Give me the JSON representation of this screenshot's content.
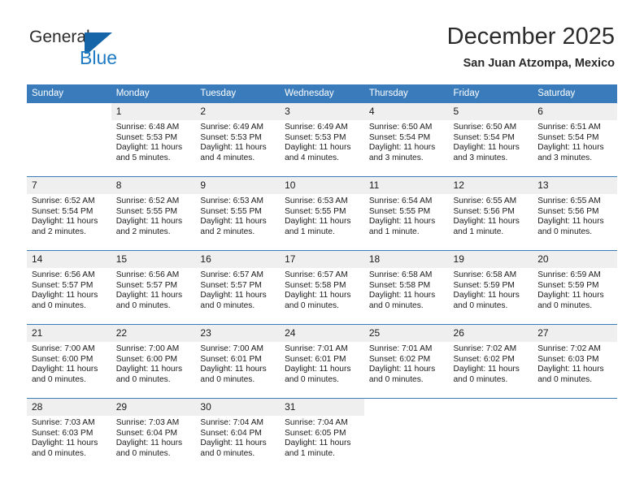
{
  "brand": {
    "name_top": "General",
    "name_bottom": "Blue",
    "mark_icon": "triangle-flag-icon",
    "color_primary": "#1565a8",
    "color_secondary": "#1f7ac4"
  },
  "header": {
    "month_title": "December 2025",
    "location": "San Juan Atzompa, Mexico"
  },
  "theme": {
    "header_row_bg": "#3a7cbb",
    "daynum_bg": "#efefef",
    "text": "#1a1a1a"
  },
  "calendar": {
    "weekday_headers": [
      "Sunday",
      "Monday",
      "Tuesday",
      "Wednesday",
      "Thursday",
      "Friday",
      "Saturday"
    ],
    "weeks": [
      [
        {
          "day": "",
          "blank": true,
          "lines": []
        },
        {
          "day": "1",
          "lines": [
            "Sunrise: 6:48 AM",
            "Sunset: 5:53 PM",
            "Daylight: 11 hours",
            "and 5 minutes."
          ]
        },
        {
          "day": "2",
          "lines": [
            "Sunrise: 6:49 AM",
            "Sunset: 5:53 PM",
            "Daylight: 11 hours",
            "and 4 minutes."
          ]
        },
        {
          "day": "3",
          "lines": [
            "Sunrise: 6:49 AM",
            "Sunset: 5:53 PM",
            "Daylight: 11 hours",
            "and 4 minutes."
          ]
        },
        {
          "day": "4",
          "lines": [
            "Sunrise: 6:50 AM",
            "Sunset: 5:54 PM",
            "Daylight: 11 hours",
            "and 3 minutes."
          ]
        },
        {
          "day": "5",
          "lines": [
            "Sunrise: 6:50 AM",
            "Sunset: 5:54 PM",
            "Daylight: 11 hours",
            "and 3 minutes."
          ]
        },
        {
          "day": "6",
          "lines": [
            "Sunrise: 6:51 AM",
            "Sunset: 5:54 PM",
            "Daylight: 11 hours",
            "and 3 minutes."
          ]
        }
      ],
      [
        {
          "day": "7",
          "lines": [
            "Sunrise: 6:52 AM",
            "Sunset: 5:54 PM",
            "Daylight: 11 hours",
            "and 2 minutes."
          ]
        },
        {
          "day": "8",
          "lines": [
            "Sunrise: 6:52 AM",
            "Sunset: 5:55 PM",
            "Daylight: 11 hours",
            "and 2 minutes."
          ]
        },
        {
          "day": "9",
          "lines": [
            "Sunrise: 6:53 AM",
            "Sunset: 5:55 PM",
            "Daylight: 11 hours",
            "and 2 minutes."
          ]
        },
        {
          "day": "10",
          "lines": [
            "Sunrise: 6:53 AM",
            "Sunset: 5:55 PM",
            "Daylight: 11 hours",
            "and 1 minute."
          ]
        },
        {
          "day": "11",
          "lines": [
            "Sunrise: 6:54 AM",
            "Sunset: 5:55 PM",
            "Daylight: 11 hours",
            "and 1 minute."
          ]
        },
        {
          "day": "12",
          "lines": [
            "Sunrise: 6:55 AM",
            "Sunset: 5:56 PM",
            "Daylight: 11 hours",
            "and 1 minute."
          ]
        },
        {
          "day": "13",
          "lines": [
            "Sunrise: 6:55 AM",
            "Sunset: 5:56 PM",
            "Daylight: 11 hours",
            "and 0 minutes."
          ]
        }
      ],
      [
        {
          "day": "14",
          "lines": [
            "Sunrise: 6:56 AM",
            "Sunset: 5:57 PM",
            "Daylight: 11 hours",
            "and 0 minutes."
          ]
        },
        {
          "day": "15",
          "lines": [
            "Sunrise: 6:56 AM",
            "Sunset: 5:57 PM",
            "Daylight: 11 hours",
            "and 0 minutes."
          ]
        },
        {
          "day": "16",
          "lines": [
            "Sunrise: 6:57 AM",
            "Sunset: 5:57 PM",
            "Daylight: 11 hours",
            "and 0 minutes."
          ]
        },
        {
          "day": "17",
          "lines": [
            "Sunrise: 6:57 AM",
            "Sunset: 5:58 PM",
            "Daylight: 11 hours",
            "and 0 minutes."
          ]
        },
        {
          "day": "18",
          "lines": [
            "Sunrise: 6:58 AM",
            "Sunset: 5:58 PM",
            "Daylight: 11 hours",
            "and 0 minutes."
          ]
        },
        {
          "day": "19",
          "lines": [
            "Sunrise: 6:58 AM",
            "Sunset: 5:59 PM",
            "Daylight: 11 hours",
            "and 0 minutes."
          ]
        },
        {
          "day": "20",
          "lines": [
            "Sunrise: 6:59 AM",
            "Sunset: 5:59 PM",
            "Daylight: 11 hours",
            "and 0 minutes."
          ]
        }
      ],
      [
        {
          "day": "21",
          "lines": [
            "Sunrise: 7:00 AM",
            "Sunset: 6:00 PM",
            "Daylight: 11 hours",
            "and 0 minutes."
          ]
        },
        {
          "day": "22",
          "lines": [
            "Sunrise: 7:00 AM",
            "Sunset: 6:00 PM",
            "Daylight: 11 hours",
            "and 0 minutes."
          ]
        },
        {
          "day": "23",
          "lines": [
            "Sunrise: 7:00 AM",
            "Sunset: 6:01 PM",
            "Daylight: 11 hours",
            "and 0 minutes."
          ]
        },
        {
          "day": "24",
          "lines": [
            "Sunrise: 7:01 AM",
            "Sunset: 6:01 PM",
            "Daylight: 11 hours",
            "and 0 minutes."
          ]
        },
        {
          "day": "25",
          "lines": [
            "Sunrise: 7:01 AM",
            "Sunset: 6:02 PM",
            "Daylight: 11 hours",
            "and 0 minutes."
          ]
        },
        {
          "day": "26",
          "lines": [
            "Sunrise: 7:02 AM",
            "Sunset: 6:02 PM",
            "Daylight: 11 hours",
            "and 0 minutes."
          ]
        },
        {
          "day": "27",
          "lines": [
            "Sunrise: 7:02 AM",
            "Sunset: 6:03 PM",
            "Daylight: 11 hours",
            "and 0 minutes."
          ]
        }
      ],
      [
        {
          "day": "28",
          "lines": [
            "Sunrise: 7:03 AM",
            "Sunset: 6:03 PM",
            "Daylight: 11 hours",
            "and 0 minutes."
          ]
        },
        {
          "day": "29",
          "lines": [
            "Sunrise: 7:03 AM",
            "Sunset: 6:04 PM",
            "Daylight: 11 hours",
            "and 0 minutes."
          ]
        },
        {
          "day": "30",
          "lines": [
            "Sunrise: 7:04 AM",
            "Sunset: 6:04 PM",
            "Daylight: 11 hours",
            "and 0 minutes."
          ]
        },
        {
          "day": "31",
          "lines": [
            "Sunrise: 7:04 AM",
            "Sunset: 6:05 PM",
            "Daylight: 11 hours",
            "and 1 minute."
          ]
        },
        {
          "day": "",
          "blank": true,
          "lines": []
        },
        {
          "day": "",
          "blank": true,
          "lines": []
        },
        {
          "day": "",
          "blank": true,
          "lines": []
        }
      ]
    ]
  }
}
